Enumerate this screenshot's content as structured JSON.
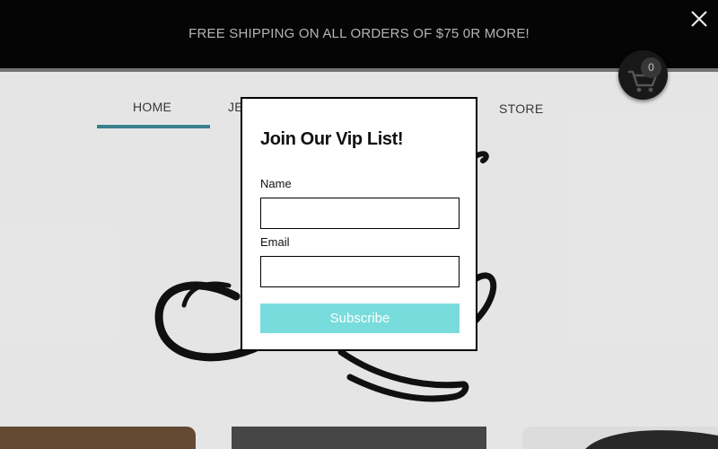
{
  "banner": {
    "promo_text": "FREE SHIPPING ON ALL ORDERS OF $75 0R MORE!"
  },
  "nav": {
    "home": "HOME",
    "partial_item": "JE",
    "store": "STORE"
  },
  "cart": {
    "count": "0",
    "icon": "shopping-cart-icon"
  },
  "close": {
    "icon": "close-icon"
  },
  "modal": {
    "title": "Join Our Vip List!",
    "name_label": "Name",
    "name_value": "",
    "email_label": "Email",
    "email_value": "",
    "subscribe_label": "Subscribe"
  },
  "colors": {
    "banner_bg": "#060606",
    "nav_active_underline": "#3d8694",
    "subscribe_bg": "#79dcdc",
    "cart_bg": "#1a1a1a"
  }
}
